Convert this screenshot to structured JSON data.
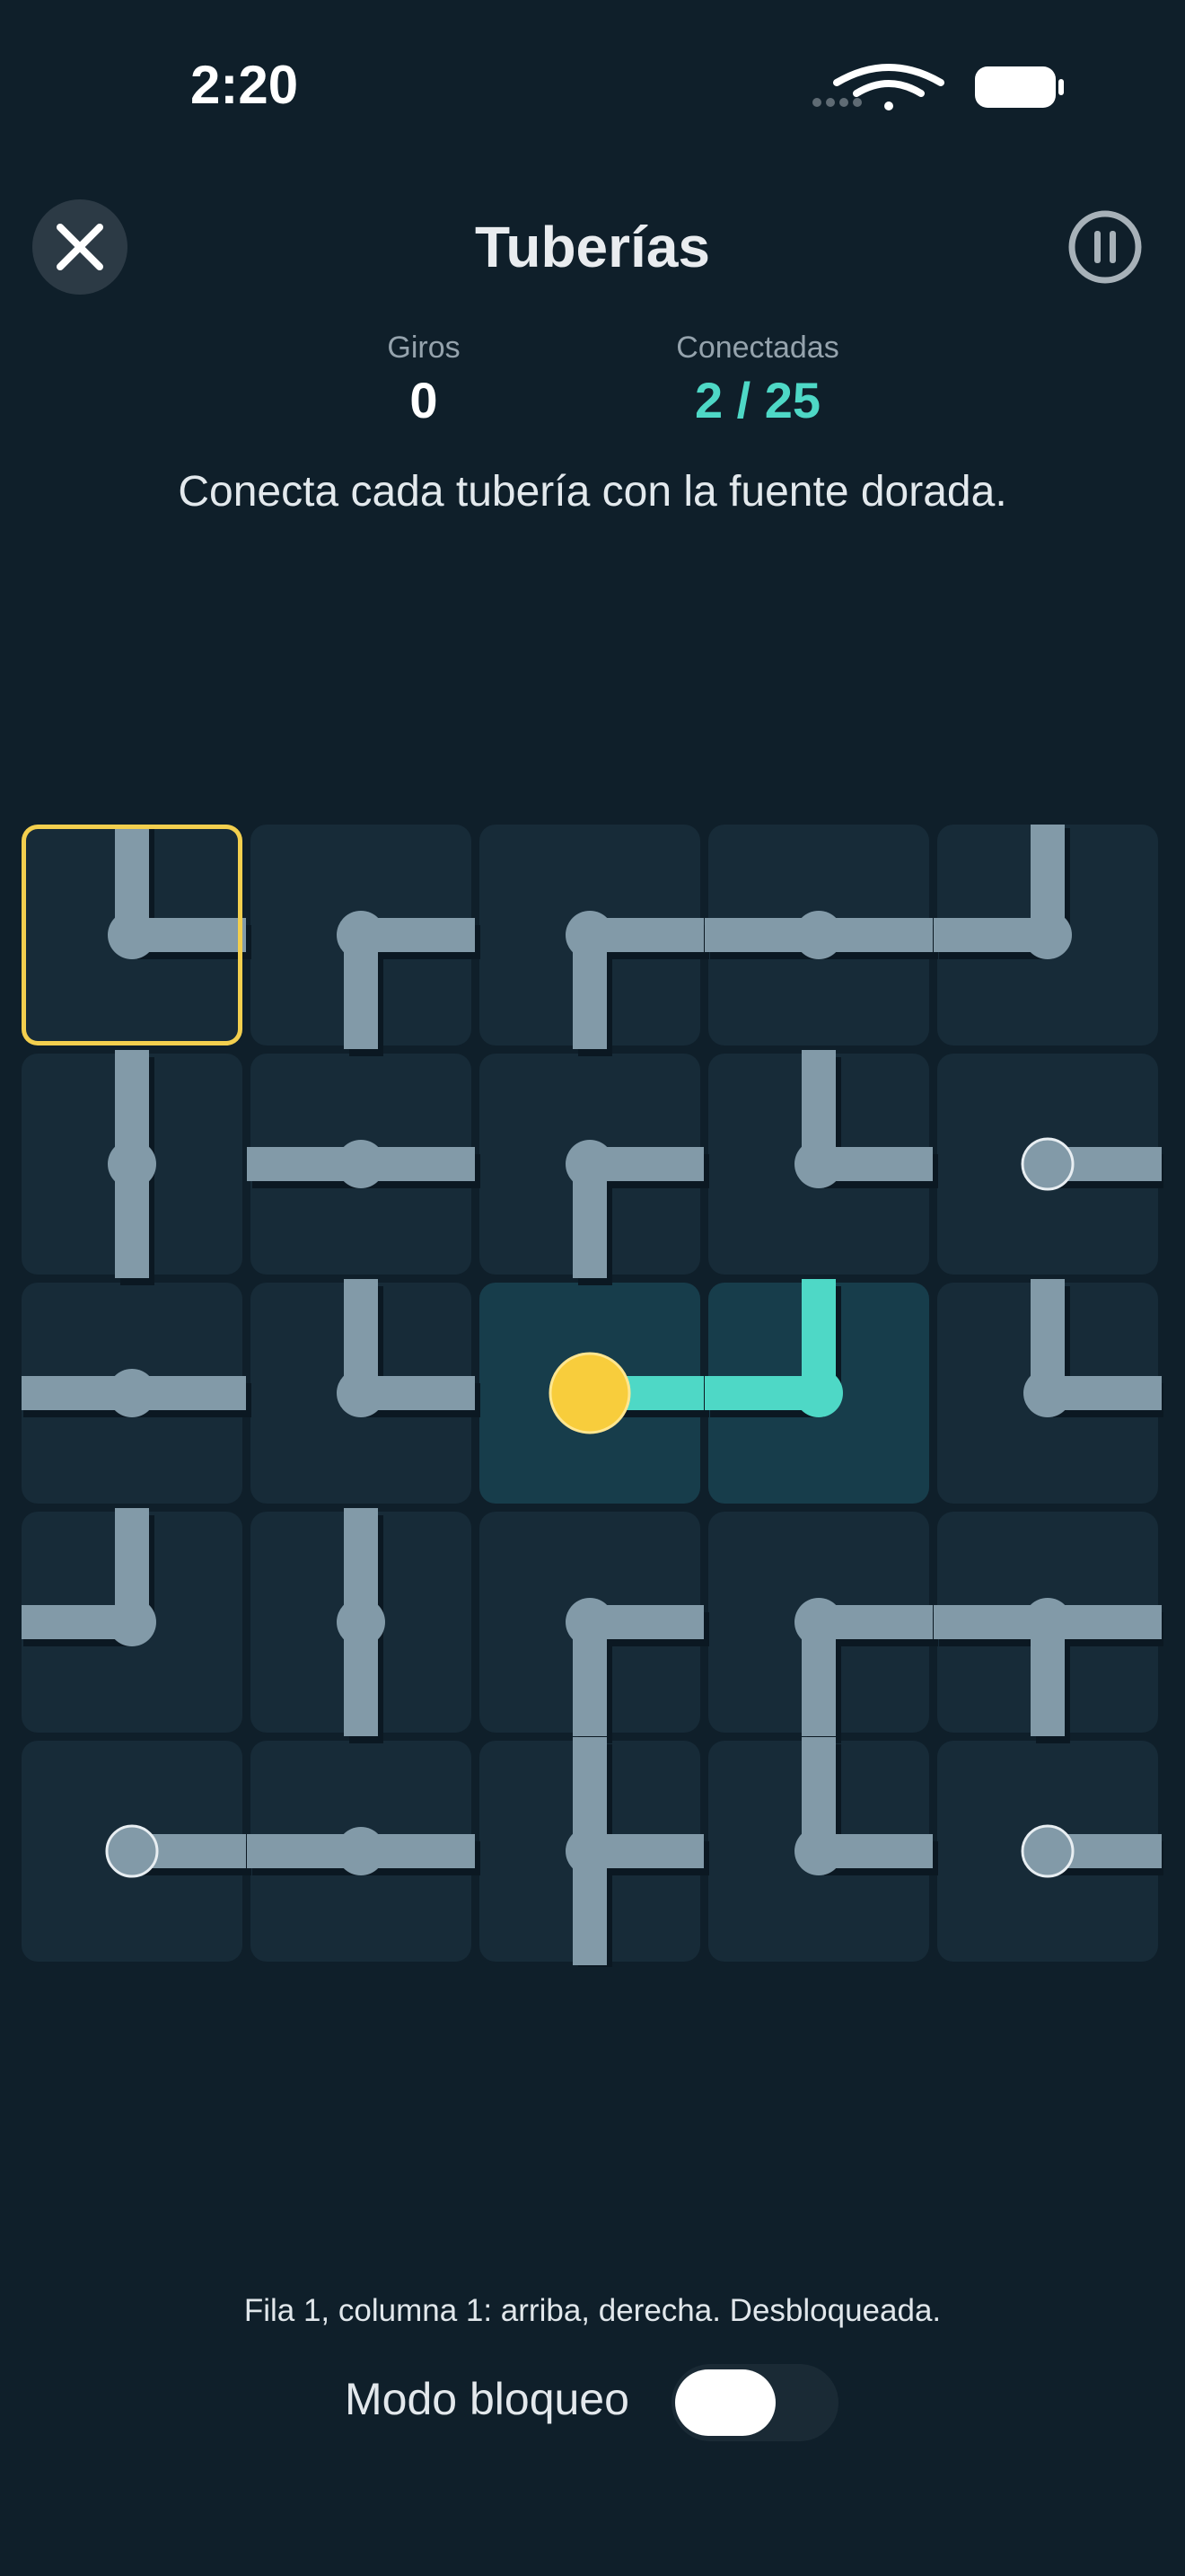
{
  "status_bar": {
    "time": "2:20"
  },
  "header": {
    "title": "Tuberías"
  },
  "stats": {
    "turns_label": "Giros",
    "turns_value": "0",
    "connected_label": "Conectadas",
    "connected_value": "2 / 25"
  },
  "instruction": "Conecta cada tubería con la fuente dorada.",
  "board": {
    "rows": 5,
    "cols": 5,
    "selected_cell": {
      "row": 1,
      "col": 1
    },
    "source_cell": {
      "row": 3,
      "col": 3
    },
    "colors": {
      "pipe": "#829aa8",
      "connected_pipe": "#4ed8c6",
      "source": "#f8cd3c",
      "selection": "#f3cf4e",
      "tile": "#172b38",
      "lit_tile": "#173d4b"
    },
    "cells": [
      [
        {
          "dirs": [
            "up",
            "right"
          ]
        },
        {
          "dirs": [
            "right",
            "down"
          ]
        },
        {
          "dirs": [
            "right",
            "down"
          ]
        },
        {
          "dirs": [
            "left",
            "right"
          ]
        },
        {
          "dirs": [
            "up",
            "left"
          ]
        }
      ],
      [
        {
          "dirs": [
            "up",
            "down"
          ]
        },
        {
          "dirs": [
            "left",
            "right"
          ]
        },
        {
          "dirs": [
            "right",
            "down"
          ]
        },
        {
          "dirs": [
            "up",
            "right"
          ]
        },
        {
          "dirs": [
            "right"
          ],
          "end": true
        }
      ],
      [
        {
          "dirs": [
            "left",
            "right"
          ]
        },
        {
          "dirs": [
            "up",
            "right"
          ]
        },
        {
          "dirs": [
            "right"
          ],
          "source": true,
          "lit": true
        },
        {
          "dirs": [
            "up",
            "left"
          ],
          "lit": true
        },
        {
          "dirs": [
            "up",
            "right"
          ]
        }
      ],
      [
        {
          "dirs": [
            "up",
            "left"
          ]
        },
        {
          "dirs": [
            "up",
            "down"
          ]
        },
        {
          "dirs": [
            "right",
            "down"
          ]
        },
        {
          "dirs": [
            "right",
            "down"
          ]
        },
        {
          "dirs": [
            "left",
            "right",
            "down"
          ]
        }
      ],
      [
        {
          "dirs": [
            "right"
          ],
          "end": true
        },
        {
          "dirs": [
            "left",
            "right"
          ]
        },
        {
          "dirs": [
            "up",
            "right",
            "down"
          ]
        },
        {
          "dirs": [
            "up",
            "right"
          ]
        },
        {
          "dirs": [
            "right"
          ],
          "end": true
        }
      ]
    ]
  },
  "footer": {
    "cell_description": "Fila 1, columna 1: arriba, derecha. Desbloqueada.",
    "lock_mode_label": "Modo bloqueo",
    "lock_mode_on": false
  }
}
